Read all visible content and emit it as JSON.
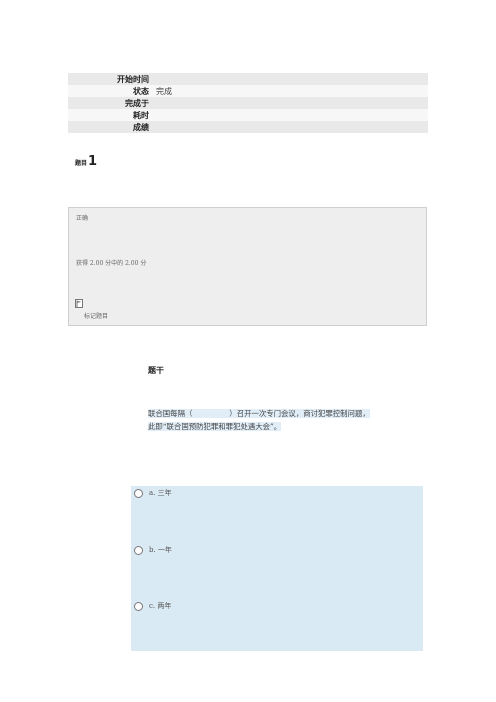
{
  "summary": {
    "rows": [
      {
        "label": "开始时间",
        "value": ""
      },
      {
        "label": "状态",
        "value": "完成"
      },
      {
        "label": "完成于",
        "value": ""
      },
      {
        "label": "耗时",
        "value": ""
      },
      {
        "label": "成绩",
        "value": ""
      }
    ]
  },
  "question": {
    "prefix": "题目",
    "number": "1",
    "state": "正确",
    "grade": "获得 2.00 分中的 2.00 分",
    "flag_label": "标记题目",
    "stem_label": "题干",
    "text_line1": "联合国每隔（　　　　　）召开一次专门会议，商讨犯罪控制问题，",
    "text_line2": "此即“联合国预防犯罪和罪犯处遇大会”。",
    "options": [
      {
        "letter": "a",
        "text": "a. 三年"
      },
      {
        "letter": "b",
        "text": "b. 一年"
      },
      {
        "letter": "c",
        "text": "c. 两年"
      }
    ]
  }
}
